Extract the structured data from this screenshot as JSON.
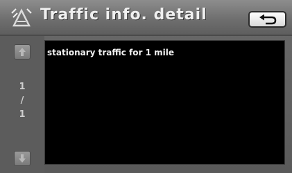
{
  "header": {
    "title": "Traffic info. detail",
    "icon": "traffic-sign-icon",
    "back_icon": "return-arrow-icon"
  },
  "pager": {
    "current": "1",
    "separator": "/",
    "total": "1",
    "up_icon": "scroll-up-icon",
    "down_icon": "scroll-down-icon"
  },
  "detail": {
    "message": "stationary traffic for 1 mile"
  }
}
